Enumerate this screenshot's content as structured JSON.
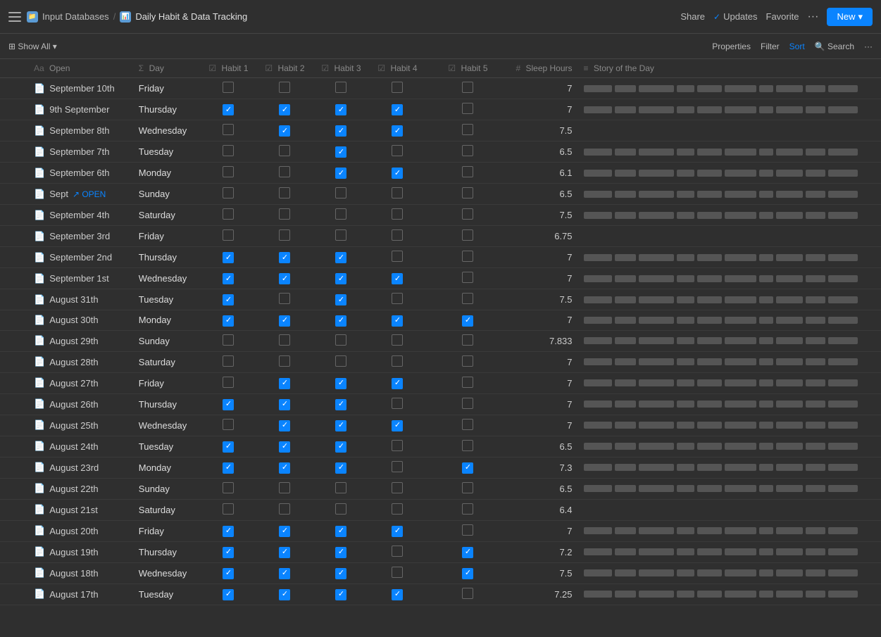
{
  "header": {
    "breadcrumb_parent": "Input Databases",
    "breadcrumb_separator": "/",
    "breadcrumb_current": "Daily Habit & Data Tracking",
    "share_label": "Share",
    "updates_label": "Updates",
    "updates_check": "✓",
    "favorite_label": "Favorite",
    "more_icon": "···",
    "new_label": "New",
    "new_chevron": "▾"
  },
  "toolbar": {
    "show_all_label": "⊞ Show All ▾",
    "properties_label": "Properties",
    "filter_label": "Filter",
    "sort_label": "Sort",
    "search_icon": "🔍",
    "search_label": "Search",
    "more_label": "···"
  },
  "columns": [
    {
      "id": "open",
      "icon": "Aa",
      "label": "Open"
    },
    {
      "id": "day",
      "icon": "Σ",
      "label": "Day"
    },
    {
      "id": "habit1",
      "icon": "☑",
      "label": "Habit 1"
    },
    {
      "id": "habit2",
      "icon": "☑",
      "label": "Habit 2"
    },
    {
      "id": "habit3",
      "icon": "☑",
      "label": "Habit 3"
    },
    {
      "id": "habit4",
      "icon": "☑",
      "label": "Habit 4"
    },
    {
      "id": "habit5",
      "icon": "☑",
      "label": "Habit 5"
    },
    {
      "id": "sleep",
      "icon": "#",
      "label": "Sleep Hours"
    },
    {
      "id": "story",
      "icon": "≡",
      "label": "Story of the Day"
    }
  ],
  "rows": [
    {
      "name": "September 10th",
      "day": "Friday",
      "h1": false,
      "h2": false,
      "h3": false,
      "h4": false,
      "h5": false,
      "sleep": "7",
      "story": true
    },
    {
      "name": "9th September",
      "day": "Thursday",
      "h1": true,
      "h2": true,
      "h3": true,
      "h4": true,
      "h5": false,
      "sleep": "7",
      "story": true
    },
    {
      "name": "September 8th",
      "day": "Wednesday",
      "h1": false,
      "h2": true,
      "h3": true,
      "h4": true,
      "h5": false,
      "sleep": "7.5",
      "story": false
    },
    {
      "name": "September 7th",
      "day": "Tuesday",
      "h1": false,
      "h2": false,
      "h3": true,
      "h4": false,
      "h5": false,
      "sleep": "6.5",
      "story": true
    },
    {
      "name": "September 6th",
      "day": "Monday",
      "h1": false,
      "h2": false,
      "h3": true,
      "h4": true,
      "h5": false,
      "sleep": "6.1",
      "story": true,
      "hover": true
    },
    {
      "name": "Sept",
      "day": "Sunday",
      "h1": false,
      "h2": false,
      "h3": false,
      "h4": false,
      "h5": false,
      "sleep": "6.5",
      "story": true,
      "open_link": true,
      "hover": true
    },
    {
      "name": "September 4th",
      "day": "Saturday",
      "h1": false,
      "h2": false,
      "h3": false,
      "h4": false,
      "h5": false,
      "sleep": "7.5",
      "story": true
    },
    {
      "name": "September 3rd",
      "day": "Friday",
      "h1": false,
      "h2": false,
      "h3": false,
      "h4": false,
      "h5": false,
      "sleep": "6.75",
      "story": false
    },
    {
      "name": "September 2nd",
      "day": "Thursday",
      "h1": true,
      "h2": true,
      "h3": true,
      "h4": false,
      "h5": false,
      "sleep": "7",
      "story": true
    },
    {
      "name": "September 1st",
      "day": "Wednesday",
      "h1": true,
      "h2": true,
      "h3": true,
      "h4": true,
      "h5": false,
      "sleep": "7",
      "story": true
    },
    {
      "name": "August 31th",
      "day": "Tuesday",
      "h1": true,
      "h2": false,
      "h3": true,
      "h4": false,
      "h5": false,
      "sleep": "7.5",
      "story": true
    },
    {
      "name": "August 30th",
      "day": "Monday",
      "h1": true,
      "h2": true,
      "h3": true,
      "h4": true,
      "h5": true,
      "sleep": "7",
      "story": true
    },
    {
      "name": "August 29th",
      "day": "Sunday",
      "h1": false,
      "h2": false,
      "h3": false,
      "h4": false,
      "h5": false,
      "sleep": "7.833",
      "story": true
    },
    {
      "name": "August 28th",
      "day": "Saturday",
      "h1": false,
      "h2": false,
      "h3": false,
      "h4": false,
      "h5": false,
      "sleep": "7",
      "story": true
    },
    {
      "name": "August 27th",
      "day": "Friday",
      "h1": false,
      "h2": true,
      "h3": true,
      "h4": true,
      "h5": false,
      "sleep": "7",
      "story": true
    },
    {
      "name": "August 26th",
      "day": "Thursday",
      "h1": true,
      "h2": true,
      "h3": true,
      "h4": false,
      "h5": false,
      "sleep": "7",
      "story": true
    },
    {
      "name": "August 25th",
      "day": "Wednesday",
      "h1": false,
      "h2": true,
      "h3": true,
      "h4": true,
      "h5": false,
      "sleep": "7",
      "story": true
    },
    {
      "name": "August 24th",
      "day": "Tuesday",
      "h1": true,
      "h2": true,
      "h3": true,
      "h4": false,
      "h5": false,
      "sleep": "6.5",
      "story": true
    },
    {
      "name": "August 23rd",
      "day": "Monday",
      "h1": true,
      "h2": true,
      "h3": true,
      "h4": false,
      "h5": true,
      "sleep": "7.3",
      "story": true
    },
    {
      "name": "August 22th",
      "day": "Sunday",
      "h1": false,
      "h2": false,
      "h3": false,
      "h4": false,
      "h5": false,
      "sleep": "6.5",
      "story": true
    },
    {
      "name": "August 21st",
      "day": "Saturday",
      "h1": false,
      "h2": false,
      "h3": false,
      "h4": false,
      "h5": false,
      "sleep": "6.4",
      "story": false
    },
    {
      "name": "August 20th",
      "day": "Friday",
      "h1": true,
      "h2": true,
      "h3": true,
      "h4": true,
      "h5": false,
      "sleep": "7",
      "story": true
    },
    {
      "name": "August 19th",
      "day": "Thursday",
      "h1": true,
      "h2": true,
      "h3": true,
      "h4": false,
      "h5": true,
      "sleep": "7.2",
      "story": true
    },
    {
      "name": "August 18th",
      "day": "Wednesday",
      "h1": true,
      "h2": true,
      "h3": true,
      "h4": false,
      "h5": true,
      "sleep": "7.5",
      "story": true
    },
    {
      "name": "August 17th",
      "day": "Tuesday",
      "h1": true,
      "h2": true,
      "h3": true,
      "h4": true,
      "h5": false,
      "sleep": "7.25",
      "story": true
    }
  ]
}
